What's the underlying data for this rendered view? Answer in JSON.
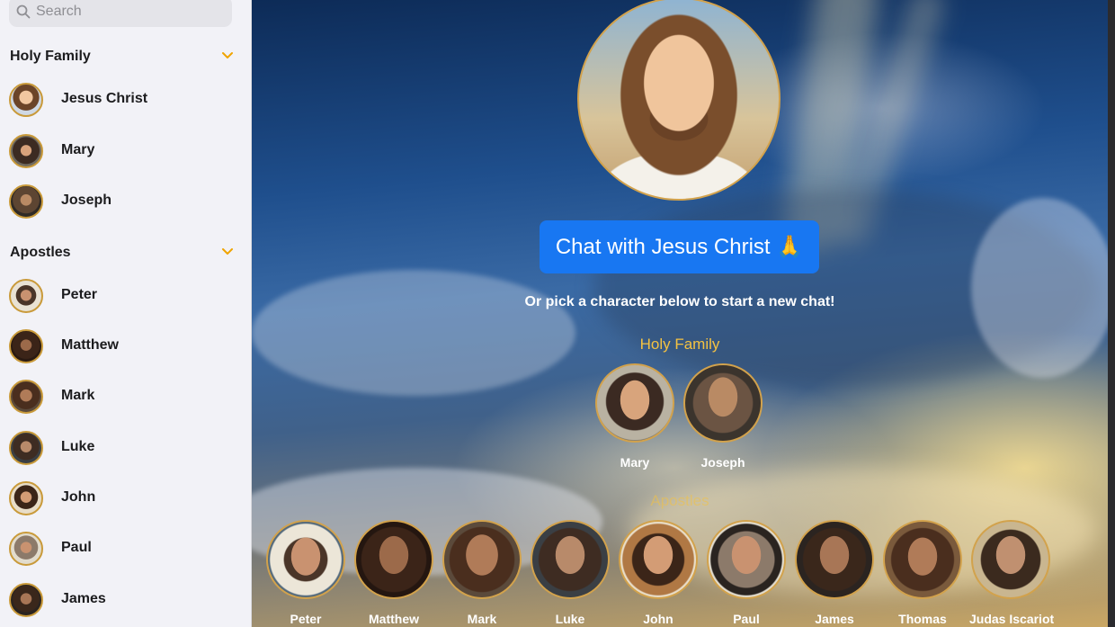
{
  "search": {
    "placeholder": "Search"
  },
  "sidebar": {
    "sections": [
      {
        "title": "Holy Family",
        "items": [
          "Jesus Christ",
          "Mary",
          "Joseph"
        ]
      },
      {
        "title": "Apostles",
        "items": [
          "Peter",
          "Matthew",
          "Mark",
          "Luke",
          "John",
          "Paul",
          "James"
        ]
      }
    ]
  },
  "main": {
    "chat_button": "Chat with Jesus Christ 🙏",
    "subtitle": "Or pick a character below to start a new chat!",
    "groups": [
      {
        "title": "Holy Family",
        "characters": [
          "Mary",
          "Joseph"
        ]
      },
      {
        "title": "Apostles",
        "characters": [
          "Peter",
          "Matthew",
          "Mark",
          "Luke",
          "John",
          "Paul",
          "James",
          "Thomas",
          "Judas Iscariot"
        ]
      }
    ]
  },
  "colors": {
    "accent": "#1877f2",
    "gold": "#f4c242",
    "chevron": "#f0a400"
  },
  "icons": {
    "search": "magnifier-icon",
    "collapse": "chevron-down-icon",
    "avatar": "portrait-avatar"
  }
}
